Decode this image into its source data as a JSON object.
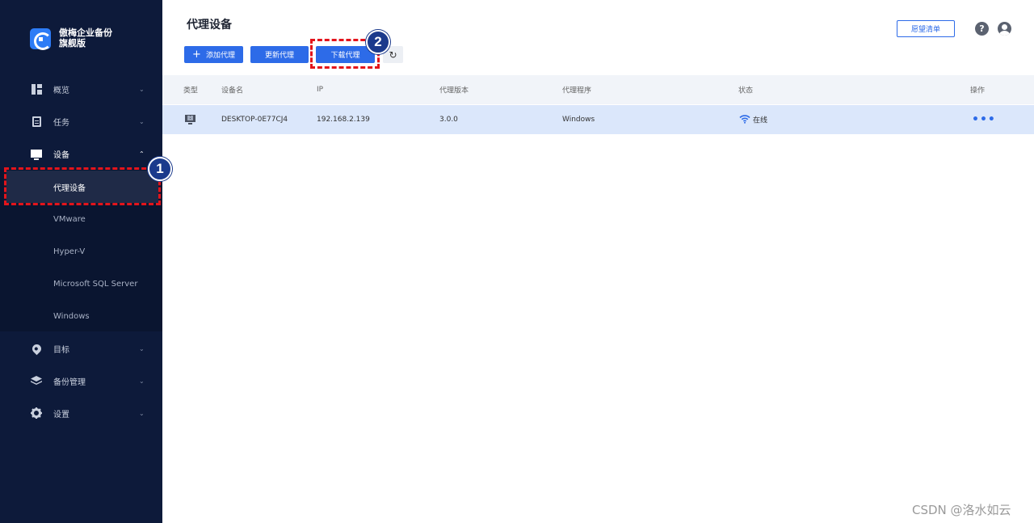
{
  "brand": {
    "line1": "傲梅企业备份",
    "line2": "旗舰版",
    "logo_color": "#2d7cf6"
  },
  "sidebar": {
    "items": [
      {
        "label": "概览",
        "chevron": "⌄"
      },
      {
        "label": "任务",
        "chevron": "⌄"
      },
      {
        "label": "设备",
        "chevron": "⌃"
      },
      {
        "label": "目标",
        "chevron": "⌄"
      },
      {
        "label": "备份管理",
        "chevron": "⌄"
      },
      {
        "label": "设置",
        "chevron": "⌄"
      }
    ],
    "device_submenu": [
      {
        "label": "代理设备",
        "active": true
      },
      {
        "label": "VMware"
      },
      {
        "label": "Hyper-V"
      },
      {
        "label": "Microsoft SQL Server"
      },
      {
        "label": "Windows"
      }
    ]
  },
  "header": {
    "title": "代理设备",
    "wishlist": "愿望清单",
    "help": "?"
  },
  "toolbar": {
    "add": "添加代理",
    "add_icon": "+",
    "update": "更新代理",
    "download": "下载代理",
    "refresh_icon": "↻"
  },
  "table": {
    "columns": [
      "类型",
      "设备名",
      "IP",
      "代理版本",
      "代理程序",
      "状态",
      "操作"
    ],
    "rows": [
      {
        "type_icon": "windows-pc-icon",
        "name": "DESKTOP-0E77CJ4",
        "ip": "192.168.2.139",
        "version": "3.0.0",
        "program": "Windows",
        "status": "在线",
        "action": "•••"
      }
    ]
  },
  "annotations": {
    "step1": "1",
    "step2": "2",
    "color": "#e3141b"
  },
  "watermark": "CSDN @洛水如云",
  "colors": {
    "sidebar_bg": "#0d1a3a",
    "primary": "#2d6be8",
    "row_selected": "#dbe7fb"
  }
}
